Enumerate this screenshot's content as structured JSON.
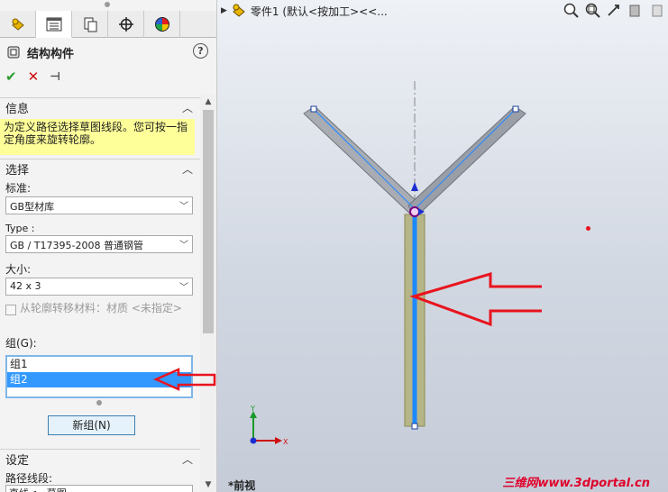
{
  "panel": {
    "tabs": [
      {
        "name": "feature-manager-tab"
      },
      {
        "name": "property-manager-tab"
      },
      {
        "name": "configuration-manager-tab"
      },
      {
        "name": "dimxpert-manager-tab"
      },
      {
        "name": "display-manager-tab"
      }
    ],
    "feature_title": "结构构件",
    "help": "?",
    "actions": {
      "ok": "✔",
      "cancel": "✕",
      "pin": "⊣"
    }
  },
  "info": {
    "heading": "信息",
    "message": "为定义路径选择草图线段。您可按一指定角度来旋转轮廓。"
  },
  "selection": {
    "heading": "选择",
    "standard_label": "标准:",
    "standard_value": "GB型材库",
    "type_label": "Type :",
    "type_value": "GB / T17395-2008 普通钢管",
    "size_label": "大小:",
    "size_value": "42 x 3",
    "transfer_label": "从轮廓转移材料：材质 <未指定>",
    "groups_label": "组(G):",
    "groups": [
      "组1",
      "组2"
    ],
    "selected_group": 1,
    "new_group_button": "新组(N)"
  },
  "settings": {
    "heading": "设定",
    "path_segment_label": "路径线段:",
    "path_segment_value": "直线<...草图"
  },
  "viewport": {
    "tree_path": "零件1 (默认<按加工><<...",
    "view_name": "*前视",
    "watermark": "三维网www.3dportal.cn",
    "triad": {
      "x": "X",
      "y": "Y"
    }
  },
  "colors": {
    "info_bg": "#ffff99",
    "selected_group": "#3399ff",
    "arrow_red": "#e8141e",
    "path_blue": "#1e88ff"
  }
}
